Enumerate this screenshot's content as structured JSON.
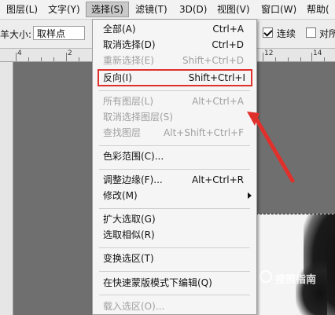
{
  "menubar": {
    "items": [
      {
        "label": "图层(L)"
      },
      {
        "label": "文字(Y)"
      },
      {
        "label": "选择(S)"
      },
      {
        "label": "滤镜(T)"
      },
      {
        "label": "3D(D)"
      },
      {
        "label": "视图(V)"
      },
      {
        "label": "窗口(W)"
      },
      {
        "label": "帮助("
      }
    ]
  },
  "options": {
    "sample_size_label": "羊大小:",
    "sample_size_value": "取样点",
    "contiguous_label": "连续",
    "contiguous_checked": true,
    "all_layers_label": "对所"
  },
  "ruler": {
    "numbers": [
      "4",
      "2",
      "12",
      "14"
    ]
  },
  "select_menu": {
    "items": [
      {
        "label": "全部(A)",
        "shortcut": "Ctrl+A",
        "enabled": true
      },
      {
        "label": "取消选择(D)",
        "shortcut": "Ctrl+D",
        "enabled": true
      },
      {
        "label": "重新选择(E)",
        "shortcut": "Shift+Ctrl+D",
        "enabled": false
      },
      {
        "label": "反向(I)",
        "shortcut": "Shift+Ctrl+I",
        "enabled": true,
        "highlighted": true
      },
      {
        "label": "所有图层(L)",
        "shortcut": "Alt+Ctrl+A",
        "enabled": false
      },
      {
        "label": "取消选择图层(S)",
        "shortcut": "",
        "enabled": false
      },
      {
        "label": "查找图层",
        "shortcut": "Alt+Shift+Ctrl+F",
        "enabled": false
      },
      {
        "label": "色彩范围(C)...",
        "shortcut": "",
        "enabled": true
      },
      {
        "label": "调整边缘(F)...",
        "shortcut": "Alt+Ctrl+R",
        "enabled": true
      },
      {
        "label": "修改(M)",
        "shortcut": "",
        "enabled": true,
        "submenu": true
      },
      {
        "label": "扩大选取(G)",
        "shortcut": "",
        "enabled": true
      },
      {
        "label": "选取相似(R)",
        "shortcut": "",
        "enabled": true
      },
      {
        "label": "变换选区(T)",
        "shortcut": "",
        "enabled": true
      },
      {
        "label": "在快速蒙版模式下编辑(Q)",
        "shortcut": "",
        "enabled": true
      },
      {
        "label": "载入选区(O)...",
        "shortcut": "",
        "enabled": false
      }
    ]
  },
  "watermark": {
    "text": "搜照指南"
  },
  "colors": {
    "highlight": "#e0302c",
    "arrow": "#e0302c"
  }
}
